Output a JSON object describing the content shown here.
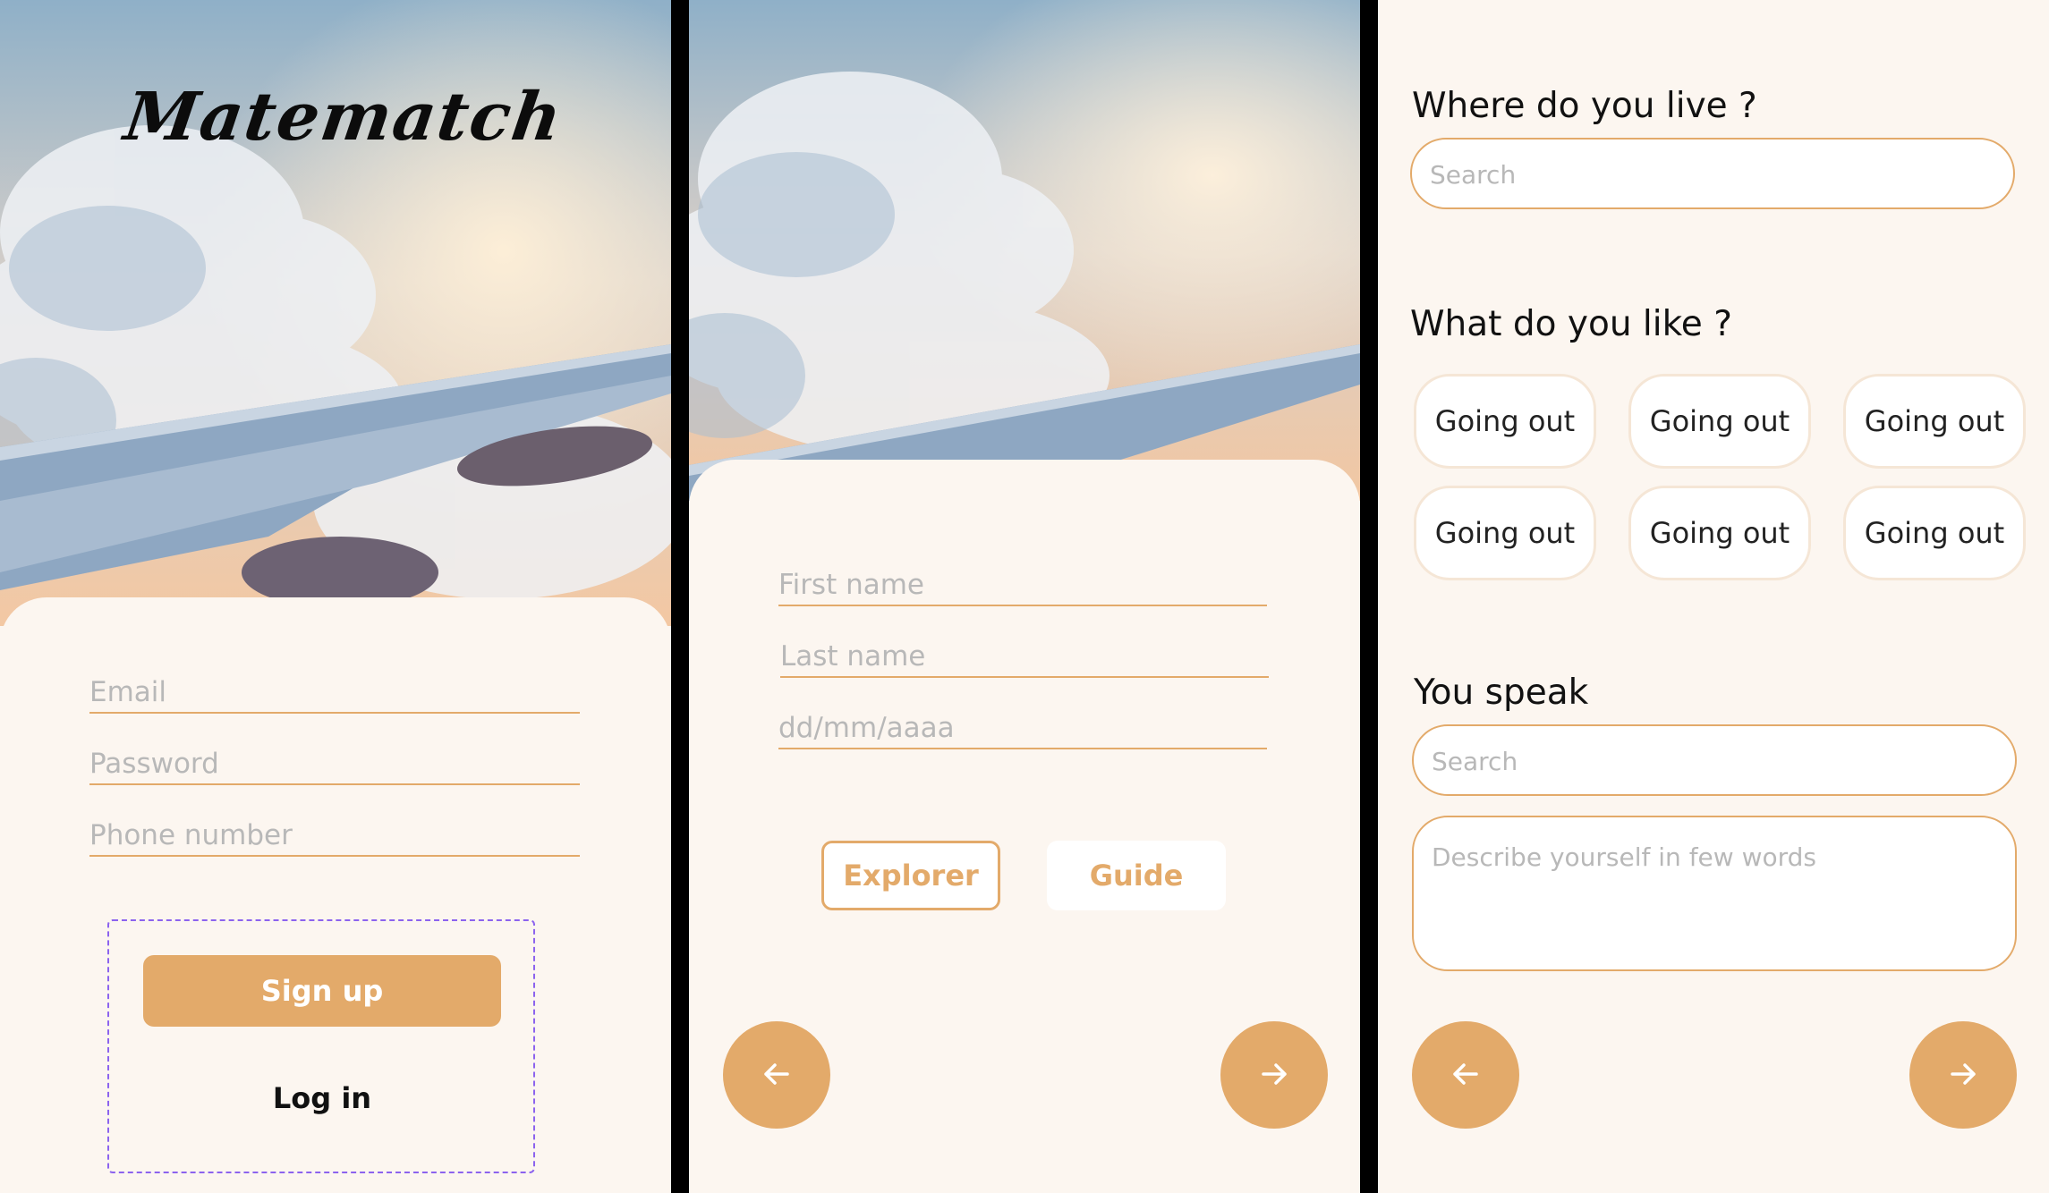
{
  "login": {
    "logo_text": "Matematch",
    "email_placeholder": "Email",
    "password_placeholder": "Password",
    "phone_placeholder": "Phone number",
    "signup_label": "Sign up",
    "login_label": "Log in"
  },
  "profile": {
    "first_name_placeholder": "First name",
    "last_name_placeholder": "Last name",
    "birthdate_placeholder": "dd/mm/aaaa",
    "role_explorer": "Explorer",
    "role_guide": "Guide"
  },
  "preferences": {
    "where_heading": "Where do you live ?",
    "where_placeholder": "Search",
    "like_heading": "What do you like ?",
    "interests": [
      "Going out",
      "Going out",
      "Going out",
      "Going out",
      "Going out",
      "Going out"
    ],
    "speak_heading": "You speak",
    "speak_placeholder": "Search",
    "describe_placeholder": "Describe yourself in few words"
  },
  "icons": {
    "back": "arrow-left-icon",
    "next": "arrow-right-icon"
  },
  "colors": {
    "accent": "#e3aa6a",
    "background": "#fcf6f0",
    "selection_outline": "#8c63ee"
  }
}
